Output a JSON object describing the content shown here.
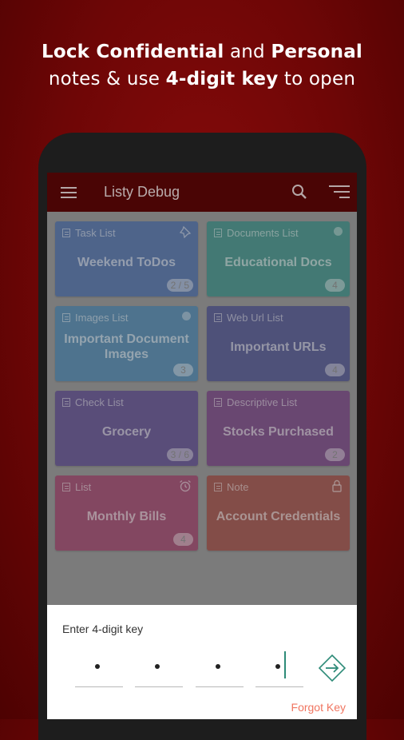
{
  "headline": {
    "line1_bold1": "Lock Confidential",
    "line1_normal": "and",
    "line1_bold2": "Personal",
    "line2_normal1": "notes &amp; use",
    "line2_bold": "4-digit key",
    "line2_normal2": "to open"
  },
  "appbar": {
    "title": "Listy Debug"
  },
  "cards": [
    {
      "type": "Task List",
      "title": "Weekend ToDos",
      "badge": "2 / 5",
      "color": "#2a5298",
      "corner": "pin-icon"
    },
    {
      "type": "Documents List",
      "title": "Educational Docs",
      "badge": "4",
      "color": "#16796f",
      "corner": "dot"
    },
    {
      "type": "Images List",
      "title": "Important Document Images",
      "badge": "3",
      "color": "#2a6e9e",
      "corner": "dot"
    },
    {
      "type": "Web Url List",
      "title": "Important URLs",
      "badge": "4",
      "color": "#2a2f78",
      "corner": ""
    },
    {
      "type": "Check List",
      "title": "Grocery",
      "badge": "3 / 6",
      "color": "#3f2978",
      "corner": ""
    },
    {
      "type": "Descriptive List",
      "title": "Stocks Purchased",
      "badge": "2",
      "color": "#5c1e6a",
      "corner": ""
    },
    {
      "type": "List",
      "title": "Monthly Bills",
      "badge": "4",
      "color": "#8a1e4c",
      "corner": "alarm-icon"
    },
    {
      "type": "Note",
      "title": "Account Credentials",
      "badge": "",
      "color": "#8b2820",
      "corner": "lock-icon"
    }
  ],
  "sheet": {
    "label": "Enter 4-digit key",
    "pin_digits_entered": 4,
    "forgot_label": "Forgot Key",
    "accent": "#2e8b78"
  }
}
